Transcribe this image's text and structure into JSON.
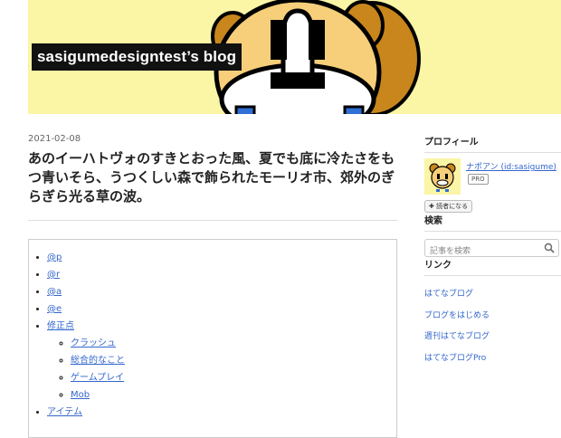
{
  "header": {
    "blog_title": "sasigumedesigntest’s blog"
  },
  "entry": {
    "date": "2021-02-08",
    "title": "あのイーハトヴォのすきとおった風、夏でも底に冷たさをもつ青いそら、うつくしい森で飾られたモーリオ市、郊外のぎらぎら光る草の波。",
    "toc": [
      {
        "label": "@p"
      },
      {
        "label": "@r"
      },
      {
        "label": "@a"
      },
      {
        "label": "@e"
      },
      {
        "label": "修正点",
        "children": [
          "クラッシュ",
          "総合的なこと",
          "ゲームプレイ",
          "Mob"
        ]
      },
      {
        "label": "アイテム"
      }
    ]
  },
  "sidebar": {
    "profile_heading": "プロフィール",
    "profile_name": "ナポアン (id:sasigume)",
    "pro_badge": "PRO",
    "follow_button": "読者になる",
    "search_heading": "検索",
    "search_placeholder": "記事を検索",
    "links_heading": "リンク",
    "links": [
      "はてなブログ",
      "ブログをはじめる",
      "週刊はてなブログ",
      "はてなブログPro"
    ]
  },
  "colors": {
    "banner": "#fbf5a6",
    "link": "#3366cc",
    "title_bg": "#111111"
  }
}
